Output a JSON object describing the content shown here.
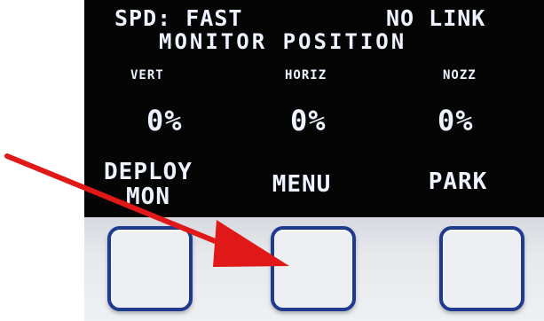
{
  "display": {
    "speed_status": "SPD: FAST",
    "link_status": "NO LINK",
    "title": "MONITOR POSITION",
    "columns": [
      {
        "label": "VERT",
        "value": "0%"
      },
      {
        "label": "HORIZ",
        "value": "0%"
      },
      {
        "label": "NOZZ",
        "value": "0%"
      }
    ],
    "softkeys": [
      {
        "label": "DEPLOY MON"
      },
      {
        "label": "MENU"
      },
      {
        "label": "PARK"
      }
    ]
  },
  "colors": {
    "lcd_background": "#050505",
    "lcd_text": "#eef3ff",
    "key_border": "#1f3b8f",
    "arrow": "#e01818"
  },
  "icons": {
    "annotation": "red-arrow-icon"
  }
}
